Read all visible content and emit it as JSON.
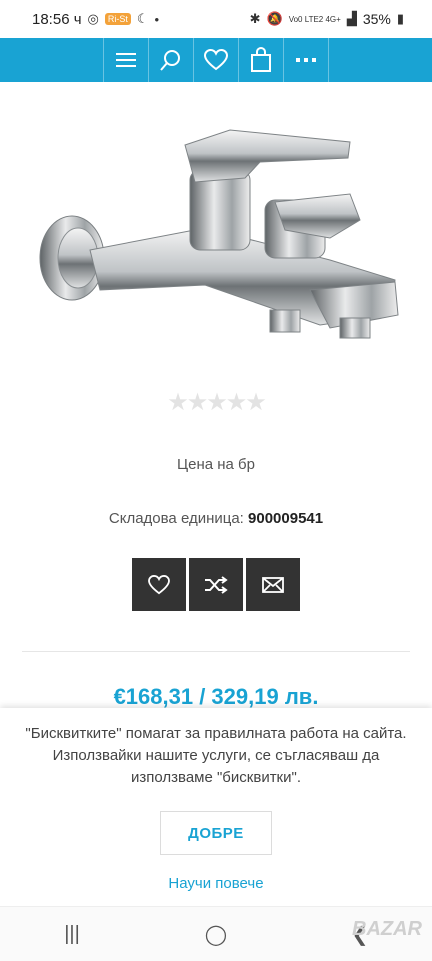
{
  "status_bar": {
    "time": "18:56 ч",
    "badge": "Ri-St",
    "battery": "35%",
    "network": "Vo0 LTE2 4G+"
  },
  "nav": {
    "icons": [
      "menu-icon",
      "search-icon",
      "heart-icon",
      "bag-icon",
      "more-icon"
    ]
  },
  "product": {
    "rating_stars": "★★★★★",
    "rating_value": 0,
    "price_unit": "Цена на бр",
    "sku_label": "Складова единица:",
    "sku_value": "900009541",
    "price": "€168,31 / 329,19 лв."
  },
  "cookie": {
    "text": "\"Бисквитките\" помагат за правилната работа на сайта. Използвайки нашите услуги, се съгласяваш да използваме \"бисквитки\".",
    "ok_label": "ДОБРЕ",
    "learn_more": "Научи повече"
  },
  "system_nav": {
    "recent": "|||",
    "home": "◯",
    "back": "❮"
  },
  "watermark": "BAZAR",
  "colors": {
    "accent": "#19a3d3",
    "button_dark": "#333333"
  }
}
